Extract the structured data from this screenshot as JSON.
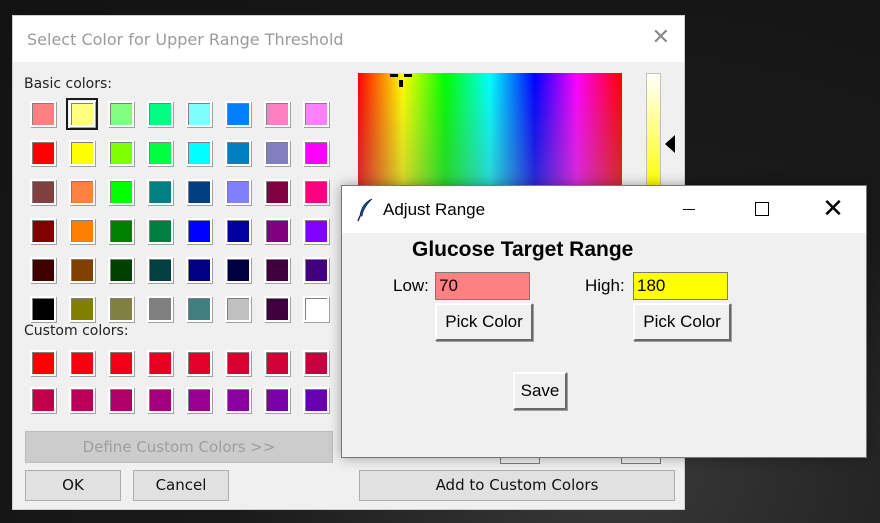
{
  "color_dialog": {
    "title": "Select Color for Upper Range Threshold",
    "close_glyph": "✕",
    "basic_colors_label": "Basic colors:",
    "custom_colors_label": "Custom colors:",
    "basic_colors": [
      "#ff8080",
      "#ffff80",
      "#80ff80",
      "#00ff80",
      "#80ffff",
      "#0080ff",
      "#ff80c0",
      "#ff80ff",
      "#ff0000",
      "#ffff00",
      "#80ff00",
      "#00ff40",
      "#00ffff",
      "#0080c0",
      "#8080c0",
      "#ff00ff",
      "#804040",
      "#ff8040",
      "#00ff00",
      "#008080",
      "#004080",
      "#8080ff",
      "#800040",
      "#ff0080",
      "#800000",
      "#ff8000",
      "#008000",
      "#008040",
      "#0000ff",
      "#0000a0",
      "#800080",
      "#8000ff",
      "#400000",
      "#804000",
      "#004000",
      "#004040",
      "#000080",
      "#000040",
      "#400040",
      "#400080",
      "#000000",
      "#808000",
      "#808040",
      "#808080",
      "#408080",
      "#c0c0c0",
      "#400040",
      "#ffffff"
    ],
    "selected_index": 1,
    "custom_colors": [
      "#ff0000",
      "#f80010",
      "#f00018",
      "#e80020",
      "#e00028",
      "#d80030",
      "#d00038",
      "#c80040",
      "#c00048",
      "#b80058",
      "#b00068",
      "#a00080",
      "#980090",
      "#8800a0",
      "#7800a8",
      "#6800b0"
    ],
    "define_custom_label": "Define Custom Colors >>",
    "ok_label": "OK",
    "cancel_label": "Cancel",
    "add_custom_label": "Add to Custom Colors"
  },
  "adjust_window": {
    "title": "Adjust Range",
    "close_glyph": "✕",
    "heading": "Glucose Target Range",
    "low_label": "Low:",
    "low_value": "70",
    "low_color": "#ff8080",
    "high_label": "High:",
    "high_value": "180",
    "high_color": "#ffff00",
    "pick_color_label": "Pick Color",
    "save_label": "Save"
  }
}
